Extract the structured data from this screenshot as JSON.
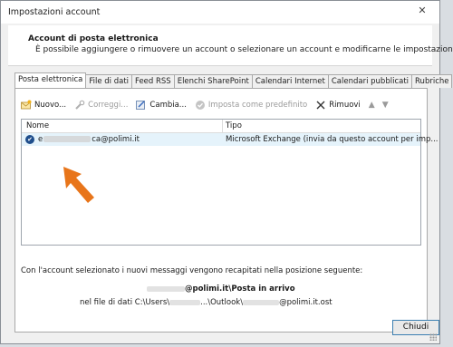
{
  "window": {
    "title": "Impostazioni account",
    "close_label": "✕"
  },
  "header": {
    "heading": "Account di posta elettronica",
    "subheading": "È possibile aggiungere o rimuovere un account o selezionare un account e modificarne le impostazioni."
  },
  "tabs": [
    {
      "label": "Posta elettronica",
      "active": true
    },
    {
      "label": "File di dati"
    },
    {
      "label": "Feed RSS"
    },
    {
      "label": "Elenchi SharePoint"
    },
    {
      "label": "Calendari Internet"
    },
    {
      "label": "Calendari pubblicati"
    },
    {
      "label": "Rubriche"
    }
  ],
  "toolbar": {
    "new_label": "Nuovo...",
    "repair_label": "Correggi...",
    "change_label": "Cambia...",
    "default_label": "Imposta come predefinito",
    "remove_label": "Rimuovi"
  },
  "list": {
    "col_name": "Nome",
    "col_type": "Tipo",
    "rows": [
      {
        "name_prefix": "e",
        "name_suffix": "ca@polimi.it",
        "type": "Microsoft Exchange (invia da questo account per imp..."
      }
    ]
  },
  "info": {
    "text": "Con l'account selezionato i nuovi messaggi vengono recapitati nella posizione seguente:",
    "path1_suffix": "@polimi.it\\Posta in arrivo",
    "path2_prefix": "nel file di dati C:\\Users\\",
    "path2_middle": "...\\Outlook\\",
    "path2_suffix": "@polimi.it.ost"
  },
  "buttons": {
    "close_label": "Chiudi"
  },
  "colors": {
    "accent": "#1f4e8c",
    "selection": "#e5f3fb",
    "callout": "#e8751a"
  }
}
